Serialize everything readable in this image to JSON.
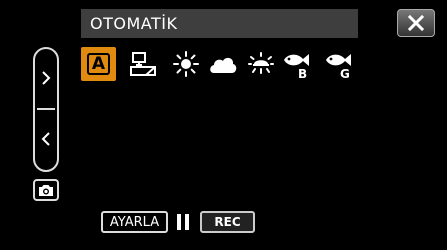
{
  "header": {
    "title": "OTOMATİK"
  },
  "controls": {
    "close_icon": "close-icon",
    "nav_up_icon": "chevron-right-icon",
    "nav_down_icon": "chevron-left-icon",
    "camera_icon": "camera-icon"
  },
  "white_balance": {
    "options": [
      {
        "name": "auto",
        "label": "A",
        "selected": true
      },
      {
        "name": "manual",
        "icon": "manual-wb-icon"
      },
      {
        "name": "fine",
        "icon": "sun-icon"
      },
      {
        "name": "cloud",
        "icon": "cloud-icon"
      },
      {
        "name": "halogen",
        "icon": "halogen-icon"
      },
      {
        "name": "marine-blue",
        "icon": "fish-icon",
        "sub": "B"
      },
      {
        "name": "marine-green",
        "icon": "fish-icon",
        "sub": "G"
      }
    ]
  },
  "bottom": {
    "adjust_label": "AYARLA",
    "pause_icon": "pause-icon",
    "rec_label": "REC"
  },
  "colors": {
    "accent": "#e08a10",
    "title_bg": "#3e3e3e",
    "background": "#000000"
  }
}
